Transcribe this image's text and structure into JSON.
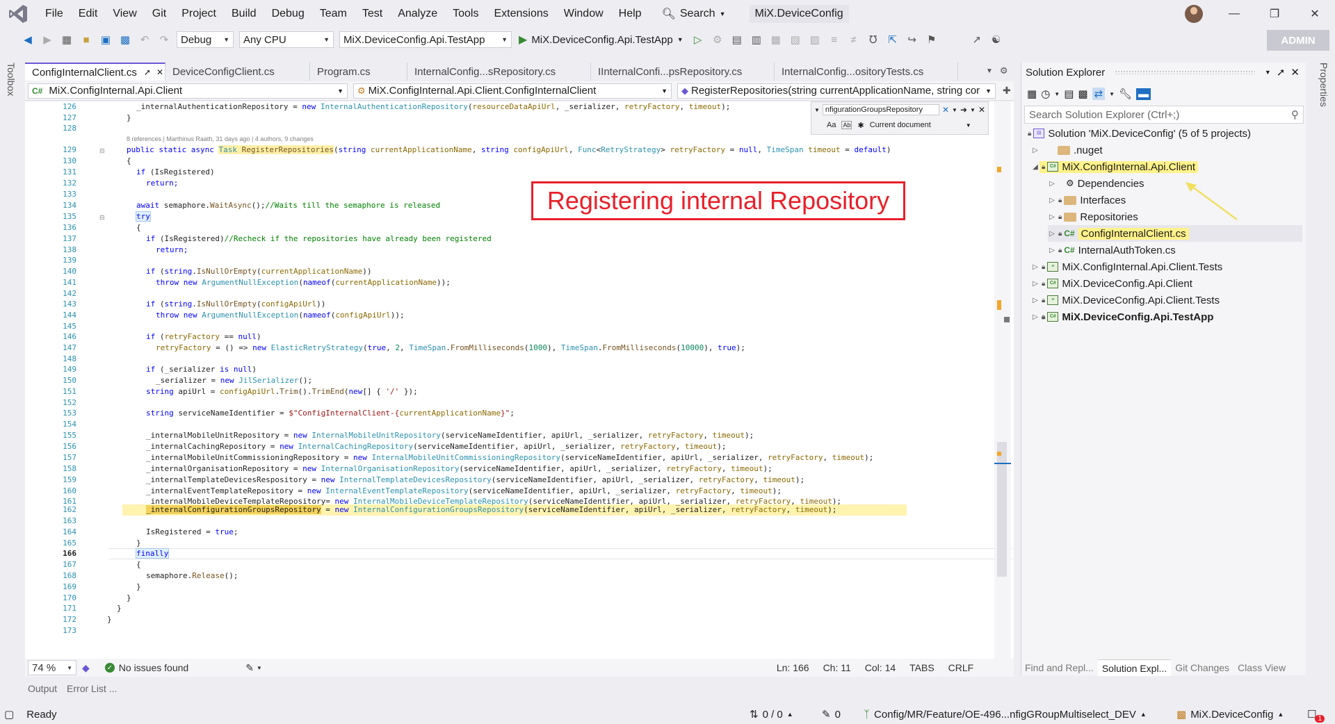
{
  "menubar": {
    "items": [
      "File",
      "Edit",
      "View",
      "Git",
      "Project",
      "Build",
      "Debug",
      "Team",
      "Test",
      "Analyze",
      "Tools",
      "Extensions",
      "Window",
      "Help"
    ],
    "search_label": "Search",
    "solution_name": "MiX.DeviceConfig"
  },
  "toolbar": {
    "config": "Debug",
    "platform": "Any CPU",
    "startup_project": "MiX.DeviceConfig.Api.TestApp",
    "run_target": "MiX.DeviceConfig.Api.TestApp",
    "admin_label": "ADMIN"
  },
  "side_labels": {
    "left": "Toolbox",
    "right": "Properties"
  },
  "tabs": [
    {
      "label": "ConfigInternalClient.cs",
      "active": true
    },
    {
      "label": "DeviceConfigClient.cs",
      "active": false
    },
    {
      "label": "Program.cs",
      "active": false
    },
    {
      "label": "InternalConfig...sRepository.cs",
      "active": false
    },
    {
      "label": "IInternalConfi...psRepository.cs",
      "active": false
    },
    {
      "label": "InternalConfig...ositoryTests.cs",
      "active": false
    }
  ],
  "navbar": {
    "project": "MiX.ConfigInternal.Api.Client",
    "type": "MiX.ConfigInternal.Api.Client.ConfigInternalClient",
    "member": "RegisterRepositories(string currentApplicationName, string cor"
  },
  "find": {
    "query": "nfigurationGroupsRepository",
    "scope": "Current document",
    "opt_case": "Aa",
    "opt_word": "Ab"
  },
  "codelens": "8 references | Marthinus Raath, 31 days ago | 4 authors, 9 changes",
  "annotation": "Registering internal Repository",
  "line_numbers": [
    126,
    127,
    128,
    129,
    130,
    131,
    132,
    133,
    134,
    135,
    136,
    137,
    138,
    139,
    140,
    141,
    142,
    143,
    144,
    145,
    146,
    147,
    148,
    149,
    150,
    151,
    152,
    153,
    154,
    155,
    156,
    157,
    158,
    159,
    160,
    161,
    162,
    163,
    164,
    165,
    166,
    167,
    168,
    169,
    170,
    171,
    172,
    173
  ],
  "code": {
    "l126": "_internalAuthenticationRepository = ",
    "l126b": "new ",
    "l126c": "InternalAuthenticationRepository",
    "l126d": "(",
    "l126e": "resourceDataApiUrl",
    "l126f": ", _serializer, ",
    "l126g": "retryFactory",
    "l126h": ", ",
    "l126i": "timeout",
    "l126j": ");",
    "l127": "}",
    "l129a": "public static async ",
    "l129b": "Task ",
    "l129c": "RegisterRepositories",
    "l129d": "(",
    "l129e": "string ",
    "l129f": "currentApplicationName",
    "l129g": ", ",
    "l129h": "string ",
    "l129i": "configApiUrl",
    "l129j": ", ",
    "l129k": "Func",
    "l129l": "<",
    "l129m": "RetryStrategy",
    "l129n": "> ",
    "l129o": "retryFactory",
    "l129p": " = ",
    "l129q": "null",
    "l129r": ", ",
    "l129s": "TimeSpan ",
    "l129t": "timeout",
    "l129u": " = ",
    "l129v": "default",
    "l129w": ")",
    "l130": "{",
    "l131a": "if ",
    "l131b": "(IsRegistered)",
    "l132": "return;",
    "l134a": "await ",
    "l134b": "semaphore.",
    "l134c": "WaitAsync",
    "l134d": "();",
    "l134e": "//Waits till the semaphore is released",
    "l135": "try",
    "l136": "{",
    "l137a": "if ",
    "l137b": "(IsRegistered)",
    "l137c": "//Recheck if the repositories have already been registered",
    "l138": "return;",
    "l140a": "if ",
    "l140b": "(",
    "l140c": "string",
    "l140d": ".",
    "l140e": "IsNullOrEmpty",
    "l140f": "(",
    "l140g": "currentApplicationName",
    "l140h": "))",
    "l141a": "throw new ",
    "l141b": "ArgumentNullException",
    "l141c": "(",
    "l141d": "nameof",
    "l141e": "(",
    "l141f": "currentApplicationName",
    "l141g": "));",
    "l143a": "if ",
    "l143b": "(",
    "l143c": "string",
    "l143d": ".",
    "l143e": "IsNullOrEmpty",
    "l143f": "(",
    "l143g": "configApiUrl",
    "l143h": "))",
    "l144a": "throw new ",
    "l144b": "ArgumentNullException",
    "l144c": "(",
    "l144d": "nameof",
    "l144e": "(",
    "l144f": "configApiUrl",
    "l144g": "));",
    "l146a": "if ",
    "l146b": "(",
    "l146c": "retryFactory",
    "l146d": " == ",
    "l146e": "null",
    "l146f": ")",
    "l147a": "retryFactory",
    "l147b": " = () => ",
    "l147c": "new ",
    "l147d": "ElasticRetryStrategy",
    "l147e": "(",
    "l147f": "true",
    "l147g": ", ",
    "l147h": "2",
    "l147i": ", ",
    "l147j": "TimeSpan",
    "l147k": ".",
    "l147l": "FromMilliseconds",
    "l147m": "(",
    "l147n": "1000",
    "l147o": "), ",
    "l147p": "TimeSpan",
    "l147q": ".",
    "l147r": "FromMilliseconds",
    "l147s": "(",
    "l147t": "10000",
    "l147u": "), ",
    "l147v": "true",
    "l147w": ");",
    "l149a": "if ",
    "l149b": "(_serializer ",
    "l149c": "is null",
    "l149d": ")",
    "l150a": "_serializer = ",
    "l150b": "new ",
    "l150c": "JilSerializer",
    "l150d": "();",
    "l151a": "string ",
    "l151b": "apiUrl = ",
    "l151c": "configApiUrl",
    "l151d": ".",
    "l151e": "Trim",
    "l151f": "().",
    "l151g": "TrimEnd",
    "l151h": "(",
    "l151i": "new",
    "l151j": "[] { ",
    "l151k": "'/'",
    "l151l": " });",
    "l153a": "string ",
    "l153b": "serviceNameIdentifier = ",
    "l153c": "$\"ConfigInternalClient-{",
    "l153d": "currentApplicationName",
    "l153e": "}\"",
    "l153f": ";",
    "l155a": "_internalMobileUnitRepository = ",
    "l155b": "new ",
    "l155c": "InternalMobileUnitRepository",
    "l155d": "(serviceNameIdentifier, apiUrl, _serializer, ",
    "l155e": "retryFactory",
    "l155f": ", ",
    "l155g": "timeout",
    "l155h": ");",
    "l156a": "_internalCachingRepository = ",
    "l156b": "new ",
    "l156c": "InternalCachingRepository",
    "l156d": "(serviceNameIdentifier, apiUrl, _serializer, ",
    "l156e": "retryFactory",
    "l156f": ", ",
    "l156g": "timeout",
    "l156h": ");",
    "l157a": "_internalMobileUnitCommissioningRepository = ",
    "l157b": "new ",
    "l157c": "InternalMobileUnitCommissioningRepository",
    "l157d": "(serviceNameIdentifier, apiUrl, _serializer, ",
    "l157e": "retryFactory",
    "l157f": ", ",
    "l157g": "timeout",
    "l157h": ");",
    "l158a": "_internalOrganisationRepository = ",
    "l158b": "new ",
    "l158c": "InternalOrganisationRepository",
    "l158d": "(serviceNameIdentifier, apiUrl, _serializer, ",
    "l158e": "retryFactory",
    "l158f": ", ",
    "l158g": "timeout",
    "l158h": ");",
    "l159a": "_internalTemplateDevicesRespository = ",
    "l159b": "new ",
    "l159c": "InternalTemplateDevicesRepository",
    "l159d": "(serviceNameIdentifier, apiUrl, _serializer, ",
    "l159e": "retryFactory",
    "l159f": ", ",
    "l159g": "timeout",
    "l159h": ");",
    "l160a": "_internalEventTemplateRepository = ",
    "l160b": "new ",
    "l160c": "InternalEventTemplateRepository",
    "l160d": "(serviceNameIdentifier, apiUrl, _serializer, ",
    "l160e": "retryFactory",
    "l160f": ", ",
    "l160g": "timeout",
    "l160h": ");",
    "l161a": "_internalMobileDeviceTemplateRepository= ",
    "l161b": "new ",
    "l161c": "InternalMobileDeviceTemplateRepository",
    "l161d": "(serviceNameIdentifier, apiUrl, _serializer, ",
    "l161e": "retryFactory",
    "l161f": ", ",
    "l161g": "timeout",
    "l161h": ");",
    "l162a": "_internalConfigurationGroupsRepository",
    "l162b": " = ",
    "l162c": "new ",
    "l162d": "InternalConfigurationGroupsRepository",
    "l162e": "(serviceNameIdentifier, apiUrl, _serializer, ",
    "l162f": "retryFactory",
    "l162g": ", ",
    "l162h": "timeout",
    "l162i": ");",
    "l164a": "IsRegistered = ",
    "l164b": "true",
    "l164c": ";",
    "l165": "}",
    "l166": "finally",
    "l167": "{",
    "l168a": "semaphore.",
    "l168b": "Release",
    "l168c": "();",
    "l169": "}",
    "l170": "}",
    "l171": "}",
    "l172": "}"
  },
  "editor_status": {
    "zoom": "74 %",
    "issues": "No issues found",
    "ln": "Ln: 166",
    "ch": "Ch: 11",
    "col": "Col: 14",
    "tabs": "TABS",
    "eol": "CRLF"
  },
  "output_tabs": [
    "Output",
    "Error List ..."
  ],
  "solution_explorer": {
    "title": "Solution Explorer",
    "search_placeholder": "Search Solution Explorer (Ctrl+;)",
    "solution": "Solution 'MiX.DeviceConfig' (5 of 5 projects)",
    "nodes": [
      {
        "label": ".nuget",
        "kind": "folder"
      },
      {
        "label": "MiX.ConfigInternal.Api.Client",
        "kind": "project"
      },
      {
        "label": "Dependencies",
        "kind": "deps"
      },
      {
        "label": "Interfaces",
        "kind": "folder"
      },
      {
        "label": "Repositories",
        "kind": "folder"
      },
      {
        "label": "ConfigInternalClient.cs",
        "kind": "cs"
      },
      {
        "label": "InternalAuthToken.cs",
        "kind": "cs"
      },
      {
        "label": "MiX.ConfigInternal.Api.Client.Tests",
        "kind": "project"
      },
      {
        "label": "MiX.DeviceConfig.Api.Client",
        "kind": "project"
      },
      {
        "label": "MiX.DeviceConfig.Api.Client.Tests",
        "kind": "project"
      },
      {
        "label": "MiX.DeviceConfig.Api.TestApp",
        "kind": "project"
      }
    ],
    "bottom_tabs": [
      "Find and Repl...",
      "Solution Expl...",
      "Git Changes",
      "Class View"
    ]
  },
  "statusbar": {
    "ready": "Ready",
    "sync": "0 / 0",
    "pending": "0",
    "branch": "Config/MR/Feature/OE-496...nfigGRoupMultiselect_DEV",
    "repo": "MiX.DeviceConfig",
    "notifications": "1"
  },
  "colors": {
    "accent": "#6b56d6",
    "annotation": "#e8202a",
    "highlight": "#fff28a"
  }
}
